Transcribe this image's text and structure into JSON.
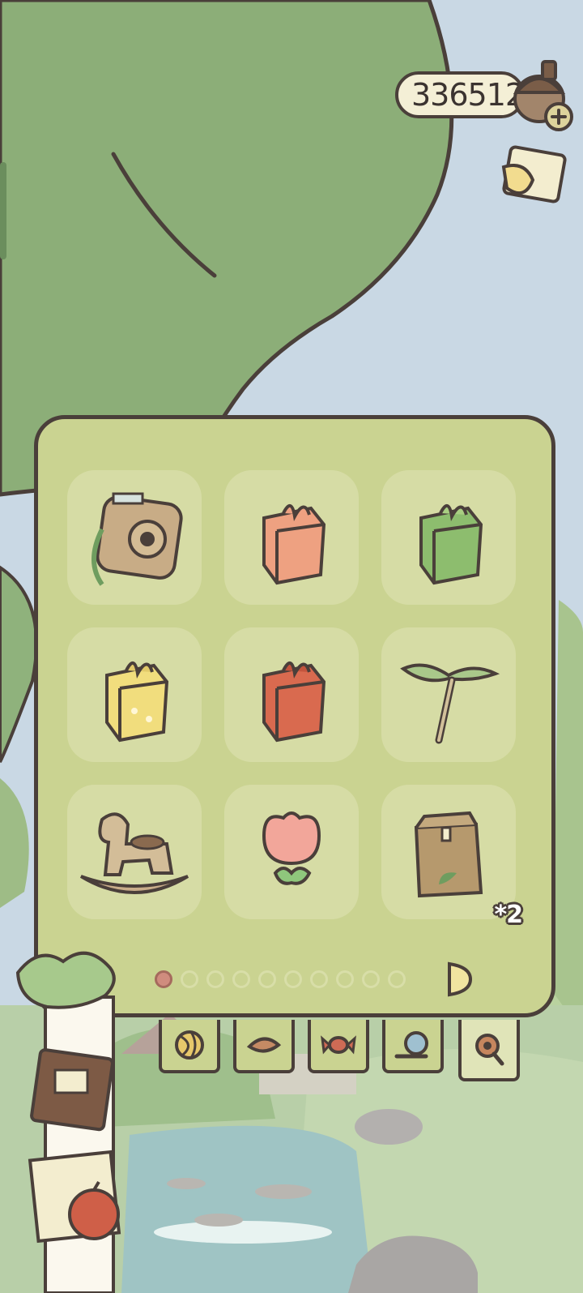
{
  "currency": {
    "acorns": "336512",
    "icon": "acorn-icon"
  },
  "inventory": {
    "items": [
      {
        "name": "instant-camera",
        "count": ""
      },
      {
        "name": "gift-box-orange-stripes",
        "count": ""
      },
      {
        "name": "gift-box-green-swirl",
        "count": ""
      },
      {
        "name": "gift-box-yellow-dots",
        "count": ""
      },
      {
        "name": "gift-box-red-pattern",
        "count": ""
      },
      {
        "name": "bamboo-copter",
        "count": ""
      },
      {
        "name": "rocking-horse",
        "count": ""
      },
      {
        "name": "tulip",
        "count": ""
      },
      {
        "name": "paper-bag",
        "count": "*2"
      }
    ],
    "page_dots": 10,
    "active_page": 1
  },
  "tabs": [
    {
      "name": "yarn-ball-tab",
      "active": false
    },
    {
      "name": "leaf-tab",
      "active": false
    },
    {
      "name": "candy-tab",
      "active": false
    },
    {
      "name": "snail-tab",
      "active": false
    },
    {
      "name": "magnifier-tab",
      "active": true
    }
  ],
  "colors": {
    "panel": "#cad391",
    "slot": "#d6dca5",
    "outline": "#4a3f3a",
    "sky": "#c9d8e4",
    "tree": "#8cae78"
  }
}
